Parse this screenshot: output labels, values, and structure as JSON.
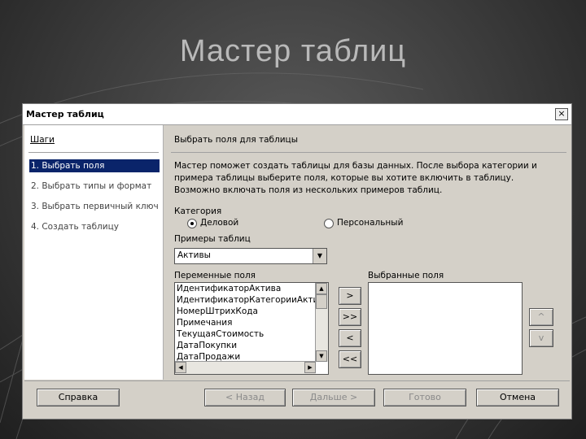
{
  "slide": {
    "title": "Мастер таблиц"
  },
  "dialog": {
    "title": "Мастер таблиц",
    "close_label": "×",
    "steps_header": "Шаги",
    "steps": [
      {
        "label": "1. Выбрать поля",
        "active": true
      },
      {
        "label": "2. Выбрать типы и формат",
        "active": false
      },
      {
        "label": "3. Выбрать первичный ключ",
        "active": false
      },
      {
        "label": "4. Создать таблицу",
        "active": false
      }
    ],
    "page_header": "Выбрать поля для таблицы",
    "description": "Мастер поможет создать таблицы для базы данных. После выбора категории и примера таблицы выберите поля, которые вы хотите включить в таблицу. Возможно включать поля из нескольких примеров таблиц.",
    "category_label": "Категория",
    "category_options": [
      {
        "label": "Деловой",
        "selected": true
      },
      {
        "label": "Персональный",
        "selected": false
      }
    ],
    "samples_label": "Примеры таблиц",
    "samples_value": "Активы",
    "available_label": "Переменные поля",
    "available_fields": [
      "ИдентификаторАктива",
      "ИдентификаторКатегорииАктива",
      "НомерШтрихКода",
      "Примечания",
      "ТекущаяСтоимость",
      "ДатаПокупки",
      "ДатаПродажи"
    ],
    "selected_label": "Выбранные поля",
    "selected_fields": [],
    "move_buttons": {
      "add": ">",
      "add_all": ">>",
      "remove": "<",
      "remove_all": "<<"
    },
    "order_buttons": {
      "up": "^",
      "down": "v"
    },
    "footer": {
      "help": "Справка",
      "back": "< Назад",
      "next": "Дальше >",
      "finish": "Готово",
      "cancel": "Отмена"
    },
    "colors": {
      "selection": "#0a246a",
      "face": "#d4d0c8"
    }
  }
}
